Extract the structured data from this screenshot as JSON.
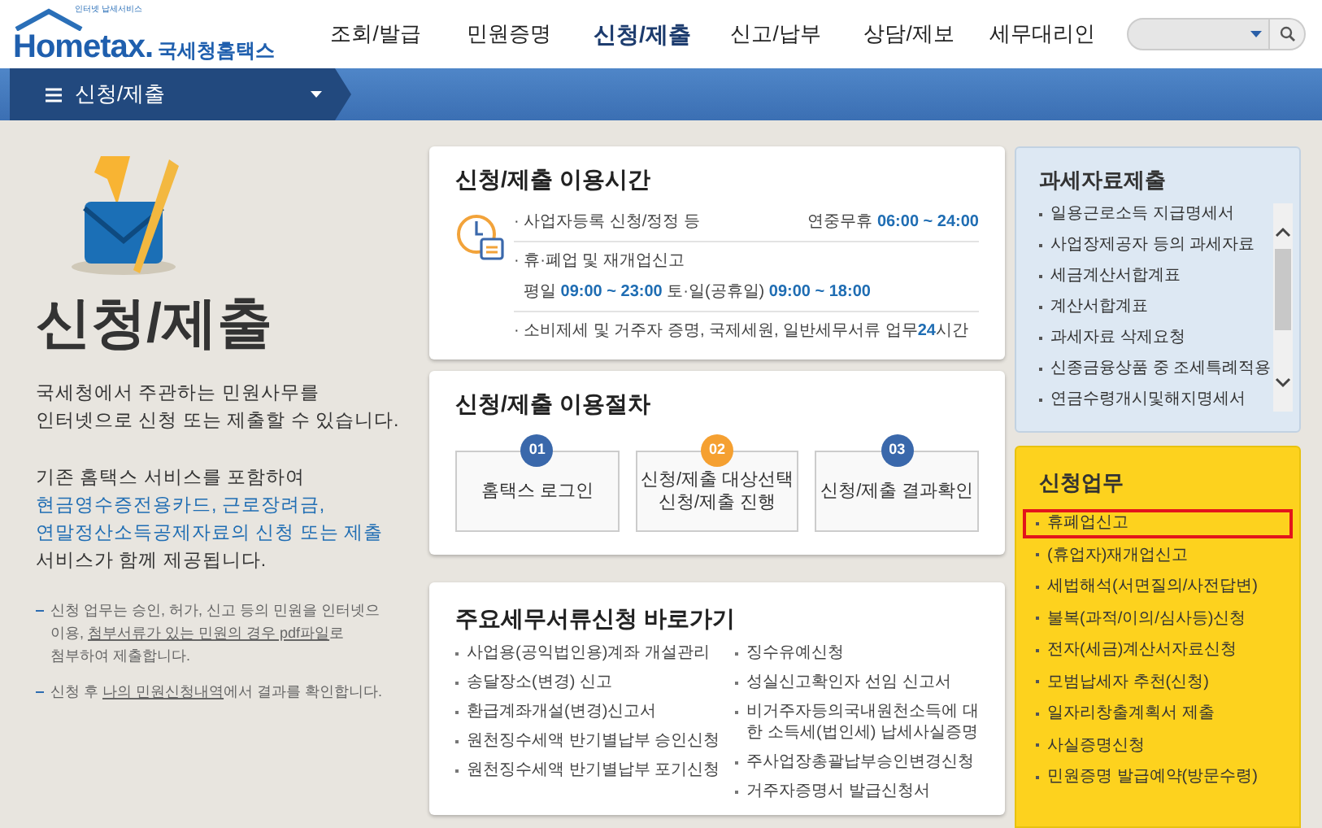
{
  "logo": {
    "tagline": "인터넷 납세서비스",
    "wordmark": "Hometax.",
    "korean": "국세청홈택스"
  },
  "nav": [
    {
      "label": "조회/발급",
      "selected": false
    },
    {
      "label": "민원증명",
      "selected": false
    },
    {
      "label": "신청/제출",
      "selected": true
    },
    {
      "label": "신고/납부",
      "selected": false
    },
    {
      "label": "상담/제보",
      "selected": false
    },
    {
      "label": "세무대리인",
      "selected": false
    }
  ],
  "breadcrumb": {
    "label": "신청/제출"
  },
  "intro": {
    "title": "신청/제출",
    "paragraphs": [
      [
        {
          "text": "국세청에서 주관하는 민원사무를\n인터넷으로 신청 또는 제출할 수 있습니다.",
          "highlight": false
        }
      ],
      [
        {
          "text": "기존 홈택스 서비스를 포함하여\n",
          "highlight": false
        },
        {
          "text": "현금영수증전용카드, 근로장려금,\n연말정산소득공제자료의 신청 또는 제출",
          "highlight": true
        },
        {
          "text": "\n서비스가 함께 제공됩니다.",
          "highlight": false
        }
      ]
    ],
    "notes": [
      [
        {
          "text": "신청 업무는 승인, 허가, 신고 등의 민원을 인터넷으\n이용, ",
          "link": false
        },
        {
          "text": "첨부서류가 있는 민원의 경우 pdf파일",
          "link": true
        },
        {
          "text": "로\n첨부하여 제출합니다.",
          "link": false
        }
      ],
      [
        {
          "text": "신청 후 ",
          "link": false
        },
        {
          "text": "나의 민원신청내역",
          "link": true
        },
        {
          "text": "에서 결과를 확인합니다.",
          "link": false
        }
      ]
    ]
  },
  "hours": {
    "title": "신청/제출 이용시간",
    "rows": [
      {
        "label": [
          {
            "text": "· 사업자등록 신청/정정 등",
            "blue": false
          }
        ],
        "detail": [
          {
            "text": "연중무휴 ",
            "blue": false
          },
          {
            "text": "06:00 ~ 24:00",
            "blue": true
          }
        ]
      },
      {
        "label": [
          {
            "text": "· 휴·폐업 및 재개업신고",
            "blue": false
          }
        ],
        "detail": [
          {
            "text": "평일 ",
            "blue": false
          },
          {
            "text": "09:00 ~ 23:00",
            "blue": true
          },
          {
            "text": " 토·일(공휴일) ",
            "blue": false
          },
          {
            "text": "09:00 ~ 18:00",
            "blue": true
          }
        ]
      },
      {
        "label": [
          {
            "text": "· 소비제세 및 거주자 증명, 국제세원, 일반세무서류 업무",
            "blue": false
          },
          {
            "text": "24",
            "blue": true
          },
          {
            "text": "시간",
            "blue": false
          }
        ]
      }
    ]
  },
  "procedure": {
    "title": "신청/제출 이용절차",
    "steps": [
      {
        "number": "01",
        "color": "#3a68ab",
        "label": "홈택스 로그인"
      },
      {
        "number": "02",
        "color": "#f5a031",
        "label": "신청/제출 대상선택\n신청/제출 진행"
      },
      {
        "number": "03",
        "color": "#3a68ab",
        "label": "신청/제출 결과확인"
      }
    ]
  },
  "shortcuts": {
    "title": "주요세무서류신청 바로가기",
    "left": [
      "사업용(공익법인용)계좌 개설관리",
      "송달장소(변경) 신고",
      "환급계좌개설(변경)신고서",
      "원천징수세액 반기별납부 승인신청",
      "원천징수세액 반기별납부 포기신청"
    ],
    "right": [
      "징수유예신청",
      "성실신고확인자 선임 신고서",
      "비거주자등의국내원천소득에 대\n한 소득세(법인세) 납세사실증명",
      "주사업장총괄납부승인변경신청",
      "거주자증명서 발급신청서"
    ]
  },
  "tax_data": {
    "title": "과세자료제출",
    "items": [
      "일용근로소득 지급명세서",
      "사업장제공자 등의 과세자료",
      "세금계산서합계표",
      "계산서합계표",
      "과세자료 삭제요청",
      "신종금융상품 중 조세특례적용",
      "연금수령개시및해지명세서"
    ]
  },
  "applications": {
    "title": "신청업무",
    "items": [
      {
        "label": "휴폐업신고",
        "selected": true
      },
      {
        "label": "(휴업자)재개업신고",
        "selected": false
      },
      {
        "label": "세법해석(서면질의/사전답변)",
        "selected": false
      },
      {
        "label": "불복(과적/이의/심사등)신청",
        "selected": false
      },
      {
        "label": "전자(세금)계산서자료신청",
        "selected": false
      },
      {
        "label": "모범납세자 추천(신청)",
        "selected": false
      },
      {
        "label": "일자리창출계획서 제출",
        "selected": false
      },
      {
        "label": "사실증명신청",
        "selected": false
      },
      {
        "label": "민원증명 발급예약(방문수령)",
        "selected": false
      }
    ]
  }
}
